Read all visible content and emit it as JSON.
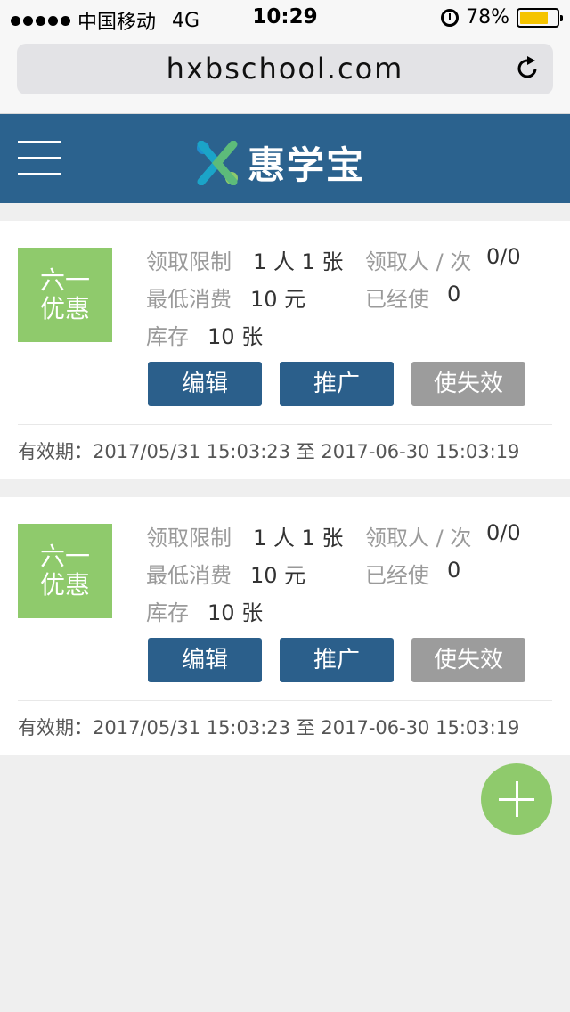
{
  "status_bar": {
    "carrier": "中国移动",
    "network": "4G",
    "time": "10:29",
    "battery": "78%",
    "battery_level": 0.78
  },
  "url_bar": {
    "url": "hxbschool.com"
  },
  "header": {
    "logo_text": "惠学宝"
  },
  "coupons": [
    {
      "badge_line1": "六一",
      "badge_line2": "优惠",
      "limit_label": "领取限制",
      "limit_value": "1 人 1 张",
      "claimed_label": "领取人 / 次",
      "claimed_value": "0/0",
      "min_label": "最低消费",
      "min_value": "10 元",
      "used_label": "已经使",
      "used_value": "0",
      "stock_label": "库存",
      "stock_value": "10 张",
      "edit_label": "编辑",
      "promote_label": "推广",
      "invalidate_label": "使失效",
      "validity": "有效期：2017/05/31 15:03:23 至 2017-06-30 15:03:19"
    },
    {
      "badge_line1": "六一",
      "badge_line2": "优惠",
      "limit_label": "领取限制",
      "limit_value": "1 人 1 张",
      "claimed_label": "领取人 / 次",
      "claimed_value": "0/0",
      "min_label": "最低消费",
      "min_value": "10 元",
      "used_label": "已经使",
      "used_value": "0",
      "stock_label": "库存",
      "stock_value": "10 张",
      "edit_label": "编辑",
      "promote_label": "推广",
      "invalidate_label": "使失效",
      "validity": "有效期：2017/05/31 15:03:23 至 2017-06-30 15:03:19"
    }
  ],
  "icons": {
    "menu": "hamburger-menu-icon",
    "reload": "reload-icon",
    "add": "plus-icon",
    "alarm": "alarm-clock-icon",
    "signal": "signal-dots-icon",
    "battery": "battery-icon"
  },
  "colors": {
    "header_bg": "#2b628e",
    "badge_green": "#8fca6c",
    "button_blue": "#2b5f8b",
    "button_gray": "#9c9c9c"
  }
}
